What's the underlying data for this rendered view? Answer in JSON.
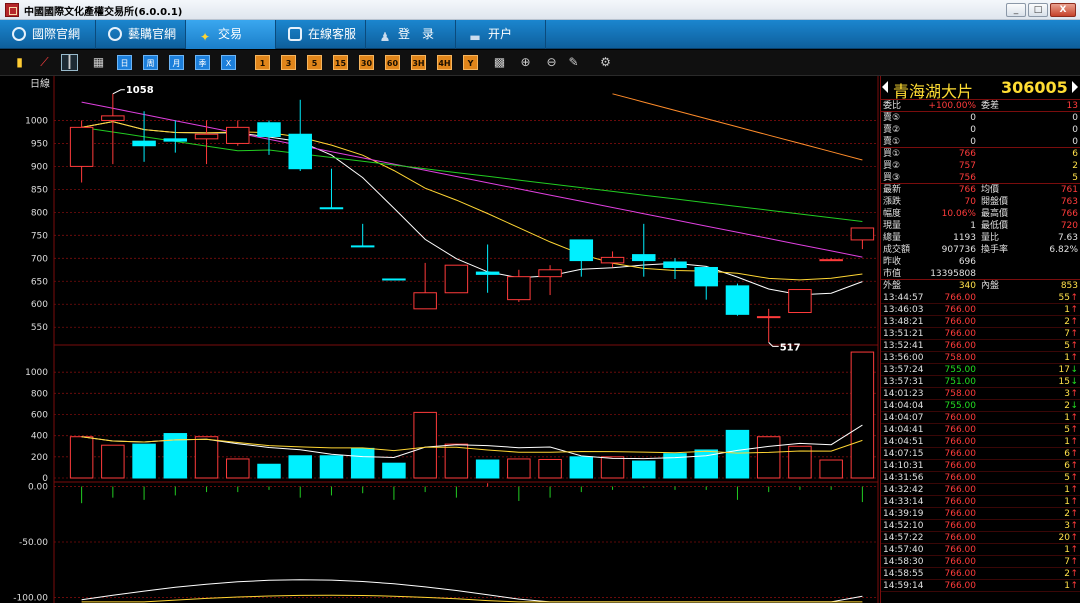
{
  "window": {
    "title": "中國國際文化產權交易所(6.0.0.1)",
    "buttons": [
      "_",
      "□",
      "X"
    ]
  },
  "nav": {
    "items": [
      {
        "label": "國際官網",
        "icon": "refresh-icon",
        "active": false
      },
      {
        "label": "藝購官網",
        "icon": "link-icon",
        "active": false
      },
      {
        "label": "交易",
        "icon": "tag-icon",
        "active": true
      },
      {
        "label": "在線客服",
        "icon": "chat-icon",
        "active": false
      },
      {
        "label": "登　录",
        "icon": "user-icon",
        "active": false
      },
      {
        "label": "开户",
        "icon": "card-icon",
        "active": false
      }
    ]
  },
  "toolbar": {
    "tools": [
      {
        "label": "",
        "icon": "bar-chart-icon",
        "style": "plain"
      },
      {
        "label": "",
        "icon": "line-chart-icon",
        "style": "plain"
      },
      {
        "label": "",
        "icon": "candlestick-icon",
        "style": "sel"
      },
      {
        "label": "",
        "icon": "calendar-icon",
        "style": "plain"
      },
      {
        "label": "日",
        "icon": "",
        "style": "blue"
      },
      {
        "label": "周",
        "icon": "",
        "style": "blue"
      },
      {
        "label": "月",
        "icon": "",
        "style": "blue"
      },
      {
        "label": "季",
        "icon": "",
        "style": "blue"
      },
      {
        "label": "X",
        "icon": "",
        "style": "blue"
      },
      {
        "label": "1",
        "icon": "",
        "style": "orange"
      },
      {
        "label": "3",
        "icon": "",
        "style": "orange"
      },
      {
        "label": "5",
        "icon": "",
        "style": "orange"
      },
      {
        "label": "15",
        "icon": "",
        "style": "orange"
      },
      {
        "label": "30",
        "icon": "",
        "style": "orange"
      },
      {
        "label": "60",
        "icon": "",
        "style": "orange"
      },
      {
        "label": "3H",
        "icon": "",
        "style": "orange"
      },
      {
        "label": "4H",
        "icon": "",
        "style": "orange"
      },
      {
        "label": "Y",
        "icon": "",
        "style": "orange"
      },
      {
        "label": "",
        "icon": "grid-icon",
        "style": "plain"
      },
      {
        "label": "",
        "icon": "zoom-in-icon",
        "style": "plain"
      },
      {
        "label": "",
        "icon": "zoom-out-icon",
        "style": "plain"
      },
      {
        "label": "",
        "icon": "draw-icon",
        "style": "plain"
      },
      {
        "label": "",
        "icon": "gear-icon",
        "style": "plain"
      }
    ]
  },
  "chart_data": {
    "type": "candlestick",
    "period_label": "日線",
    "price_axis": {
      "ticks": [
        1000,
        950,
        900,
        850,
        800,
        750,
        700,
        650,
        600,
        550
      ],
      "range": [
        520,
        1075
      ]
    },
    "volume_axis": {
      "ticks": [
        1000,
        800,
        600,
        400,
        200,
        0
      ],
      "range": [
        0,
        1200
      ]
    },
    "indicator_axis": {
      "ticks": [
        "0.00",
        "-50.00",
        "-100.00"
      ],
      "range": [
        -105,
        5
      ]
    },
    "annotations": {
      "high": "1058",
      "low": "517"
    },
    "candles": [
      {
        "o": 900,
        "c": 985,
        "h": 1000,
        "l": 865,
        "v": 390
      },
      {
        "o": 1000,
        "c": 1010,
        "h": 1058,
        "l": 905,
        "v": 310
      },
      {
        "o": 955,
        "c": 945,
        "h": 1020,
        "l": 910,
        "v": 320
      },
      {
        "o": 960,
        "c": 955,
        "h": 1000,
        "l": 930,
        "v": 420
      },
      {
        "o": 960,
        "c": 970,
        "h": 1000,
        "l": 905,
        "v": 390
      },
      {
        "o": 950,
        "c": 985,
        "h": 1000,
        "l": 945,
        "v": 180
      },
      {
        "o": 995,
        "c": 965,
        "h": 1000,
        "l": 925,
        "v": 130
      },
      {
        "o": 970,
        "c": 895,
        "h": 1045,
        "l": 890,
        "v": 210
      },
      {
        "o": 810,
        "c": 808,
        "h": 895,
        "l": 808,
        "v": 210
      },
      {
        "o": 727,
        "c": 725,
        "h": 775,
        "l": 725,
        "v": 280
      },
      {
        "o": 655,
        "c": 653,
        "h": 655,
        "l": 653,
        "v": 140
      },
      {
        "o": 590,
        "c": 625,
        "h": 690,
        "l": 590,
        "v": 620
      },
      {
        "o": 625,
        "c": 685,
        "h": 685,
        "l": 625,
        "v": 320
      },
      {
        "o": 670,
        "c": 665,
        "h": 730,
        "l": 625,
        "v": 170
      },
      {
        "o": 610,
        "c": 660,
        "h": 675,
        "l": 605,
        "v": 180
      },
      {
        "o": 660,
        "c": 675,
        "h": 685,
        "l": 620,
        "v": 175
      },
      {
        "o": 740,
        "c": 695,
        "h": 740,
        "l": 660,
        "v": 200
      },
      {
        "o": 690,
        "c": 702,
        "h": 715,
        "l": 680,
        "v": 200
      },
      {
        "o": 708,
        "c": 695,
        "h": 775,
        "l": 660,
        "v": 160
      },
      {
        "o": 692,
        "c": 680,
        "h": 700,
        "l": 655,
        "v": 230
      },
      {
        "o": 680,
        "c": 640,
        "h": 680,
        "l": 610,
        "v": 265
      },
      {
        "o": 640,
        "c": 578,
        "h": 645,
        "l": 575,
        "v": 450
      },
      {
        "o": 573,
        "c": 573,
        "h": 590,
        "l": 517,
        "v": 390
      },
      {
        "o": 582,
        "c": 632,
        "h": 632,
        "l": 582,
        "v": 300
      },
      {
        "o": 697,
        "c": 697,
        "h": 700,
        "l": 697,
        "v": 170
      },
      {
        "o": 740,
        "c": 766,
        "h": 766,
        "l": 720,
        "v": 1190
      }
    ],
    "indicator_bars": [
      -15,
      -10,
      -12,
      -8,
      -5,
      -5,
      -3,
      -10,
      -8,
      -6,
      -12,
      -5,
      -10,
      3,
      -13,
      -10,
      -5,
      -3,
      -1,
      -3,
      -3,
      -12,
      -5,
      -3,
      -3,
      -14
    ]
  },
  "panel": {
    "name": "青海湖大片",
    "code": "306005",
    "stats": [
      {
        "l": "委比",
        "v": "+100.00%",
        "l2": "委差",
        "v2": "13",
        "vc": "r",
        "v2c": "r"
      },
      {
        "l": "賣⑤",
        "v": "0",
        "l2": "",
        "v2": "0",
        "vc": "w",
        "v2c": "w"
      },
      {
        "l": "賣②",
        "v": "0",
        "l2": "",
        "v2": "0",
        "vc": "w",
        "v2c": "w"
      },
      {
        "l": "賣①",
        "v": "0",
        "l2": "",
        "v2": "0",
        "vc": "w",
        "v2c": "w"
      },
      {
        "l": "買①",
        "v": "766",
        "l2": "",
        "v2": "6",
        "vc": "r",
        "v2c": "y"
      },
      {
        "l": "買②",
        "v": "757",
        "l2": "",
        "v2": "2",
        "vc": "r",
        "v2c": "y"
      },
      {
        "l": "買③",
        "v": "756",
        "l2": "",
        "v2": "5",
        "vc": "r",
        "v2c": "y"
      },
      {
        "l": "最新",
        "v": "766",
        "l2": "均價",
        "v2": "761",
        "vc": "r",
        "v2c": "r"
      },
      {
        "l": "漲跌",
        "v": "70",
        "l2": "開盤價",
        "v2": "763",
        "vc": "r",
        "v2c": "r"
      },
      {
        "l": "幅度",
        "v": "10.06%",
        "l2": "最高價",
        "v2": "766",
        "vc": "r",
        "v2c": "r"
      },
      {
        "l": "現量",
        "v": "1",
        "l2": "最低價",
        "v2": "720",
        "vc": "w",
        "v2c": "r"
      },
      {
        "l": "總量",
        "v": "1193",
        "l2": "量比",
        "v2": "7.63",
        "vc": "w",
        "v2c": "w"
      },
      {
        "l": "成交額",
        "v": "907736",
        "l2": "換手率",
        "v2": "6.82%",
        "vc": "w",
        "v2c": "w"
      },
      {
        "l": "昨收",
        "v": "696",
        "l2": "",
        "v2": "",
        "vc": "w",
        "v2c": "w"
      },
      {
        "l": "市值",
        "v": "13395808",
        "l2": "",
        "v2": "",
        "vc": "w",
        "v2c": "w"
      },
      {
        "l": "外盤",
        "v": "340",
        "l2": "內盤",
        "v2": "853",
        "vc": "y",
        "v2c": "y"
      }
    ],
    "ticks": [
      {
        "t": "13:44:57",
        "p": "766.00",
        "q": "55",
        "d": "up"
      },
      {
        "t": "13:46:03",
        "p": "766.00",
        "q": "1",
        "d": "up"
      },
      {
        "t": "13:48:21",
        "p": "766.00",
        "q": "2",
        "d": "up"
      },
      {
        "t": "13:51:21",
        "p": "766.00",
        "q": "7",
        "d": "up"
      },
      {
        "t": "13:52:41",
        "p": "766.00",
        "q": "5",
        "d": "up"
      },
      {
        "t": "13:56:00",
        "p": "758.00",
        "q": "1",
        "d": "up"
      },
      {
        "t": "13:57:24",
        "p": "755.00",
        "q": "17",
        "d": "down"
      },
      {
        "t": "13:57:31",
        "p": "751.00",
        "q": "15",
        "d": "down"
      },
      {
        "t": "14:01:23",
        "p": "758.00",
        "q": "3",
        "d": "up"
      },
      {
        "t": "14:04:04",
        "p": "755.00",
        "q": "2",
        "d": "down"
      },
      {
        "t": "14:04:07",
        "p": "760.00",
        "q": "1",
        "d": "up"
      },
      {
        "t": "14:04:41",
        "p": "766.00",
        "q": "5",
        "d": "up"
      },
      {
        "t": "14:04:51",
        "p": "766.00",
        "q": "1",
        "d": "up"
      },
      {
        "t": "14:07:15",
        "p": "766.00",
        "q": "6",
        "d": "up"
      },
      {
        "t": "14:10:31",
        "p": "766.00",
        "q": "6",
        "d": "up"
      },
      {
        "t": "14:31:56",
        "p": "766.00",
        "q": "5",
        "d": "up"
      },
      {
        "t": "14:32:42",
        "p": "766.00",
        "q": "1",
        "d": "up"
      },
      {
        "t": "14:33:14",
        "p": "766.00",
        "q": "1",
        "d": "up"
      },
      {
        "t": "14:39:19",
        "p": "766.00",
        "q": "2",
        "d": "up"
      },
      {
        "t": "14:52:10",
        "p": "766.00",
        "q": "3",
        "d": "up"
      },
      {
        "t": "14:57:22",
        "p": "766.00",
        "q": "20",
        "d": "up"
      },
      {
        "t": "14:57:40",
        "p": "766.00",
        "q": "1",
        "d": "up"
      },
      {
        "t": "14:58:30",
        "p": "766.00",
        "q": "7",
        "d": "up"
      },
      {
        "t": "14:58:55",
        "p": "766.00",
        "q": "2",
        "d": "up"
      },
      {
        "t": "14:59:14",
        "p": "766.00",
        "q": "1",
        "d": "up"
      }
    ]
  },
  "colors": {
    "up": "#ff3b3b",
    "down": "#00f0ff",
    "grid": "#7a0d0d",
    "ma5": "#ffffff",
    "ma10": "#ffd633",
    "ma20": "#e040e0",
    "ma30": "#22cc22",
    "ma60": "#ff8c2a"
  }
}
